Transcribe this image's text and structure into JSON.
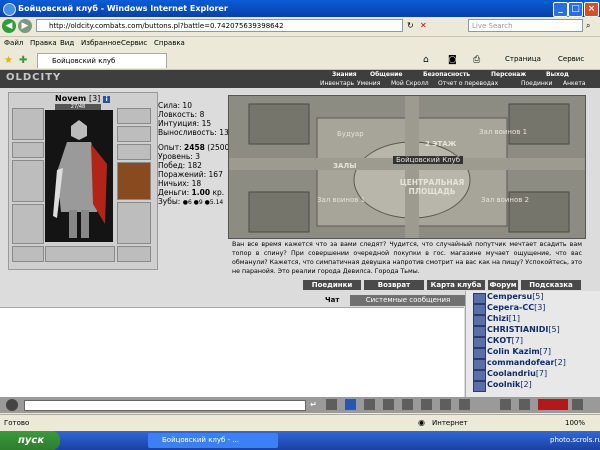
{
  "window": {
    "title": "Бойцовский клуб - Windows Internet Explorer"
  },
  "address_bar": {
    "url": "http://oldcity.combats.com/buttons.pl?battle=0.742075639398642",
    "search_placeholder": "Live Search"
  },
  "menu": {
    "items": [
      "Файл",
      "Правка",
      "Вид",
      "Избранное",
      "Сервис",
      "Справка"
    ]
  },
  "tabs": {
    "active_tab": "Бойцовский клуб",
    "page_label": "Страница",
    "tools_label": "Сервис"
  },
  "game": {
    "logo": "OLDCITY",
    "nav_top": [
      "Знания",
      "Общение",
      "Безопасность",
      "Персонаж",
      "Выход"
    ],
    "nav_bottom": [
      "Инвентарь",
      "Умения",
      "Мой Скролл",
      "Отчет о переводах",
      "Поединки",
      "Анкета"
    ],
    "character": {
      "name": "Novem",
      "level": "[3]",
      "hp": "27/48",
      "stats": [
        {
          "label": "Сила:",
          "value": "10"
        },
        {
          "label": "Ловкость:",
          "value": "8"
        },
        {
          "label": "Интуиция:",
          "value": "15"
        },
        {
          "label": "Выносливость:",
          "value": "13"
        }
      ],
      "experience_label": "Опыт:",
      "experience_value": "2458",
      "experience_next": "(2500)",
      "level_label": "Уровень:",
      "level_value": "3",
      "wins_label": "Побед:",
      "wins_value": "182",
      "losses_label": "Поражений:",
      "losses_value": "167",
      "draws_label": "Ничьих:",
      "draws_value": "18",
      "money_label": "Деньги:",
      "money_value": "1.00",
      "money_unit": "кр.",
      "teeth_label": "Зубы:",
      "teeth_value": "●6 ●9 ●5.14"
    },
    "map": {
      "labels": [
        "Будуар",
        "Зал воинов 1",
        "2 ЭТАЖ",
        "Бойцовский Клуб",
        "ЗАЛЫ",
        "ЦЕНТРАЛЬНАЯ ПЛОЩАДЬ",
        "Зал воинов 1",
        "Зал воинов 2"
      ]
    },
    "description": "Ван все время кажется что за вами следят? Чудится, что случайный попутчик мечтает всадить вам топор в спину? При совершении очередной покупки в гос. магазине мучает ощущение, что вас обманули? Кажется, что симпатичная девушка напротив смотрит на вас как на пищу? Успокойтесь, это не паранойя. Это реалии города Девилса. Города Тьмы.",
    "buttons": [
      "Поединки",
      "Возврат",
      "Карта клуба",
      "Форум",
      "Подсказка"
    ],
    "chat_tabs": [
      "Чат",
      "Системные сообщения"
    ],
    "users": [
      {
        "name": "Сеmpersu",
        "level": "[5]"
      },
      {
        "name": "Серега-СС",
        "level": "[3]"
      },
      {
        "name": "Chizi",
        "level": "[1]"
      },
      {
        "name": "CHRISTIANIDI",
        "level": "[5]"
      },
      {
        "name": "СКОТ",
        "level": "[7]"
      },
      {
        "name": "Colin Kazim",
        "level": "[7]"
      },
      {
        "name": "commandofear",
        "level": "[2]"
      },
      {
        "name": "Coolandriu",
        "level": "[7]"
      },
      {
        "name": "Coolnik",
        "level": "[2]"
      }
    ]
  },
  "statusbar": {
    "left": "Готово",
    "zone": "Интернет",
    "zoom": "100%"
  },
  "taskbar": {
    "start_label": "пуск",
    "task_item": "Бойцовский клуб - ...",
    "watermark": "photo.scrols.ru"
  }
}
